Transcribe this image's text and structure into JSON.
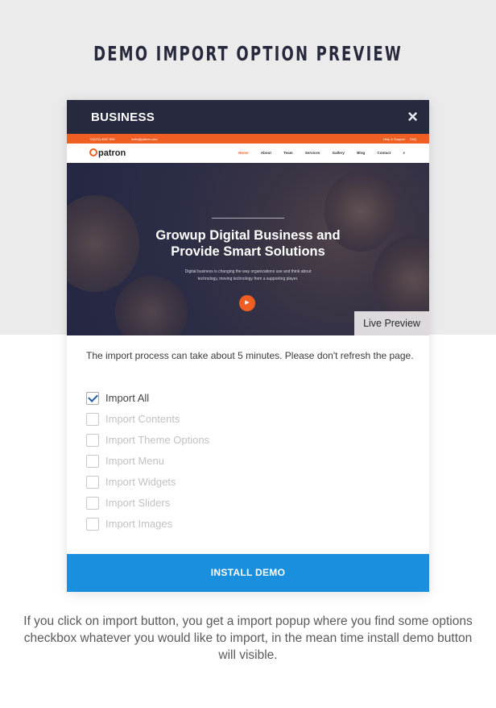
{
  "heading": "DEMO IMPORT OPTION PREVIEW",
  "modal": {
    "title": "BUSINESS",
    "close_icon": "×",
    "live_preview_label": "Live Preview",
    "notice": "The import process can take about 5 minutes. Please don't refresh the page.",
    "options": [
      {
        "label": "Import All",
        "checked": true
      },
      {
        "label": "Import Contents",
        "checked": false
      },
      {
        "label": "Import Theme Options",
        "checked": false
      },
      {
        "label": "Import Menu",
        "checked": false
      },
      {
        "label": "Import Widgets",
        "checked": false
      },
      {
        "label": "Import Sliders",
        "checked": false
      },
      {
        "label": "Import Images",
        "checked": false
      }
    ],
    "install_button": "INSTALL DEMO"
  },
  "site_preview": {
    "topbar_phone": "+0(123) 4567 890",
    "topbar_email": "hello@patron.com",
    "topbar_help": "Help & Support",
    "topbar_faq": "FAQ",
    "logo": "patron",
    "nav": [
      "Home",
      "About",
      "Team",
      "Services",
      "Gallery",
      "Blog",
      "Contact"
    ],
    "hero_title_line1": "Growup Digital Business and",
    "hero_title_line2": "Provide Smart Solutions",
    "hero_sub_line1": "Digital business is changing the way organizations use and think about",
    "hero_sub_line2": "technology, moving technology from a supporting player.",
    "play_icon": "▶"
  },
  "caption": "If you click on import button, you get a import popup where you find some options checkbox whatever you would like to import, in the mean time install demo button will visible.",
  "colors": {
    "header_bg": "#272a3f",
    "accent_orange": "#ef5f24",
    "install_blue": "#1a8fde"
  }
}
